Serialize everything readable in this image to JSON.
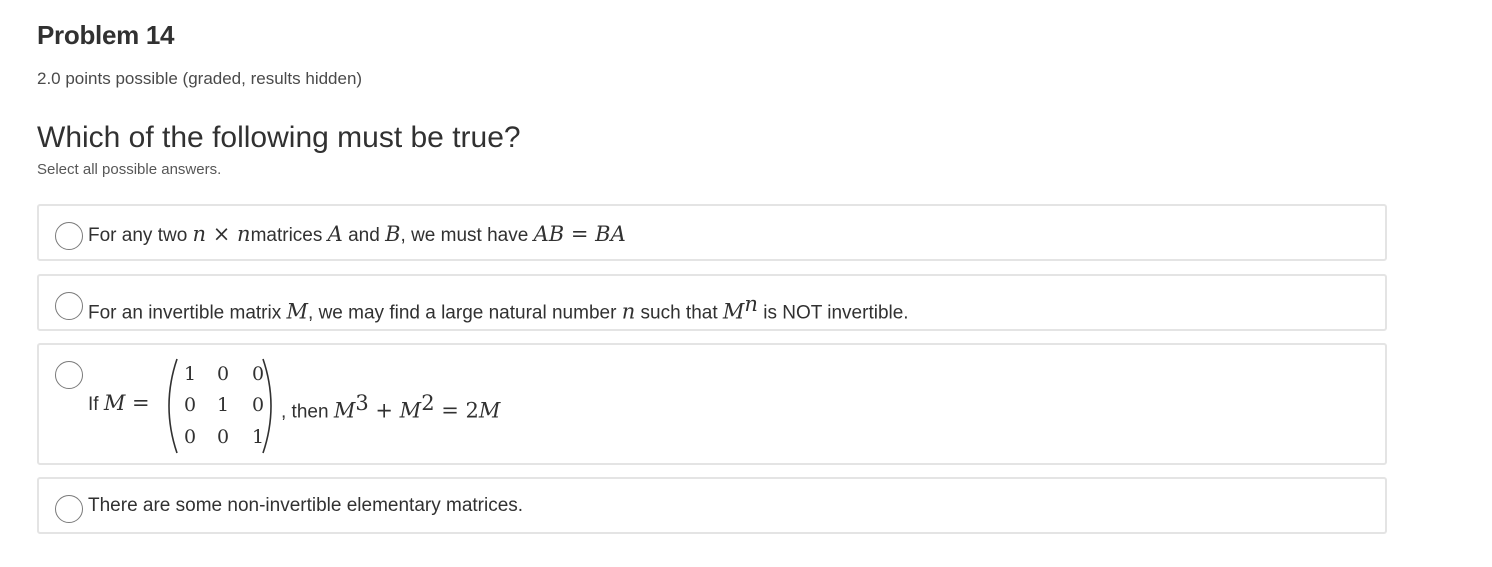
{
  "problem": {
    "title": "Problem 14",
    "points": "2.0 points possible (graded, results hidden)"
  },
  "question": {
    "text": "Which of the following must be true?",
    "instruction": "Select all possible answers."
  },
  "choices": [
    {
      "parts": [
        "For any two ",
        "n",
        " × ",
        "n",
        "matrices ",
        "A",
        " and ",
        "B",
        ", we must have ",
        "AB",
        " = ",
        "BA"
      ],
      "selected": false
    },
    {
      "parts": [
        "For an invertible matrix ",
        "M",
        ", we may find a large natural number ",
        "n",
        " such that ",
        "M",
        "n",
        " is NOT invertible."
      ],
      "selected": false
    },
    {
      "parts": [
        "If ",
        "M",
        " = ",
        ", then ",
        "M",
        "3",
        " + ",
        "M",
        "2",
        " = 2",
        "M"
      ],
      "matrix": [
        [
          "1",
          "0",
          "0"
        ],
        [
          "0",
          "1",
          "0"
        ],
        [
          "0",
          "0",
          "1"
        ]
      ],
      "selected": false
    },
    {
      "parts": [
        "There are some non-invertible elementary matrices."
      ],
      "selected": false
    }
  ],
  "colors": {
    "border": "#e4e4e4",
    "text": "#313131",
    "radio_border": "#7a7a7a"
  }
}
